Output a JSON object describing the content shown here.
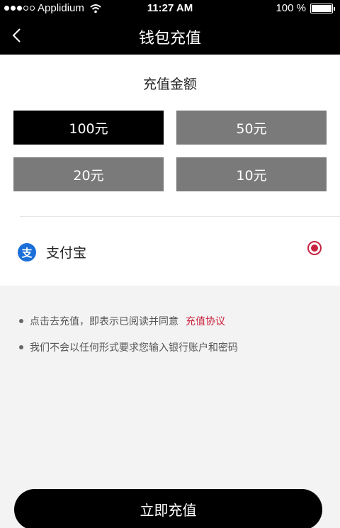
{
  "status_bar": {
    "carrier": "Applidium",
    "time": "11:27 AM",
    "battery": "100 %",
    "battery_level": 1.0,
    "signal_dots_filled": 3,
    "signal_dots_total": 5
  },
  "nav": {
    "title": "钱包充值",
    "back_icon": "chevron-left-icon"
  },
  "amount": {
    "heading": "充值金额",
    "options": [
      {
        "label": "100元",
        "selected": true
      },
      {
        "label": "50元",
        "selected": false
      },
      {
        "label": "20元",
        "selected": false
      },
      {
        "label": "10元",
        "selected": false
      }
    ]
  },
  "payment": {
    "method_label": "支付宝",
    "icon_glyph": "支",
    "selected": true
  },
  "notes": {
    "agreement_prefix": "点击去充值，即表示已阅读并同意",
    "agreement_link": "充值协议",
    "security_note": "我们不会以任何形式要求您输入银行账户和密码"
  },
  "submit": {
    "label": "立即充值"
  },
  "colors": {
    "header_bg": "#000000",
    "selected_option": "#000000",
    "option_bg": "#7a7a7a",
    "accent": "#c8233f",
    "alipay_blue": "#1a6fd8",
    "page_bg": "#f3f3f3"
  }
}
